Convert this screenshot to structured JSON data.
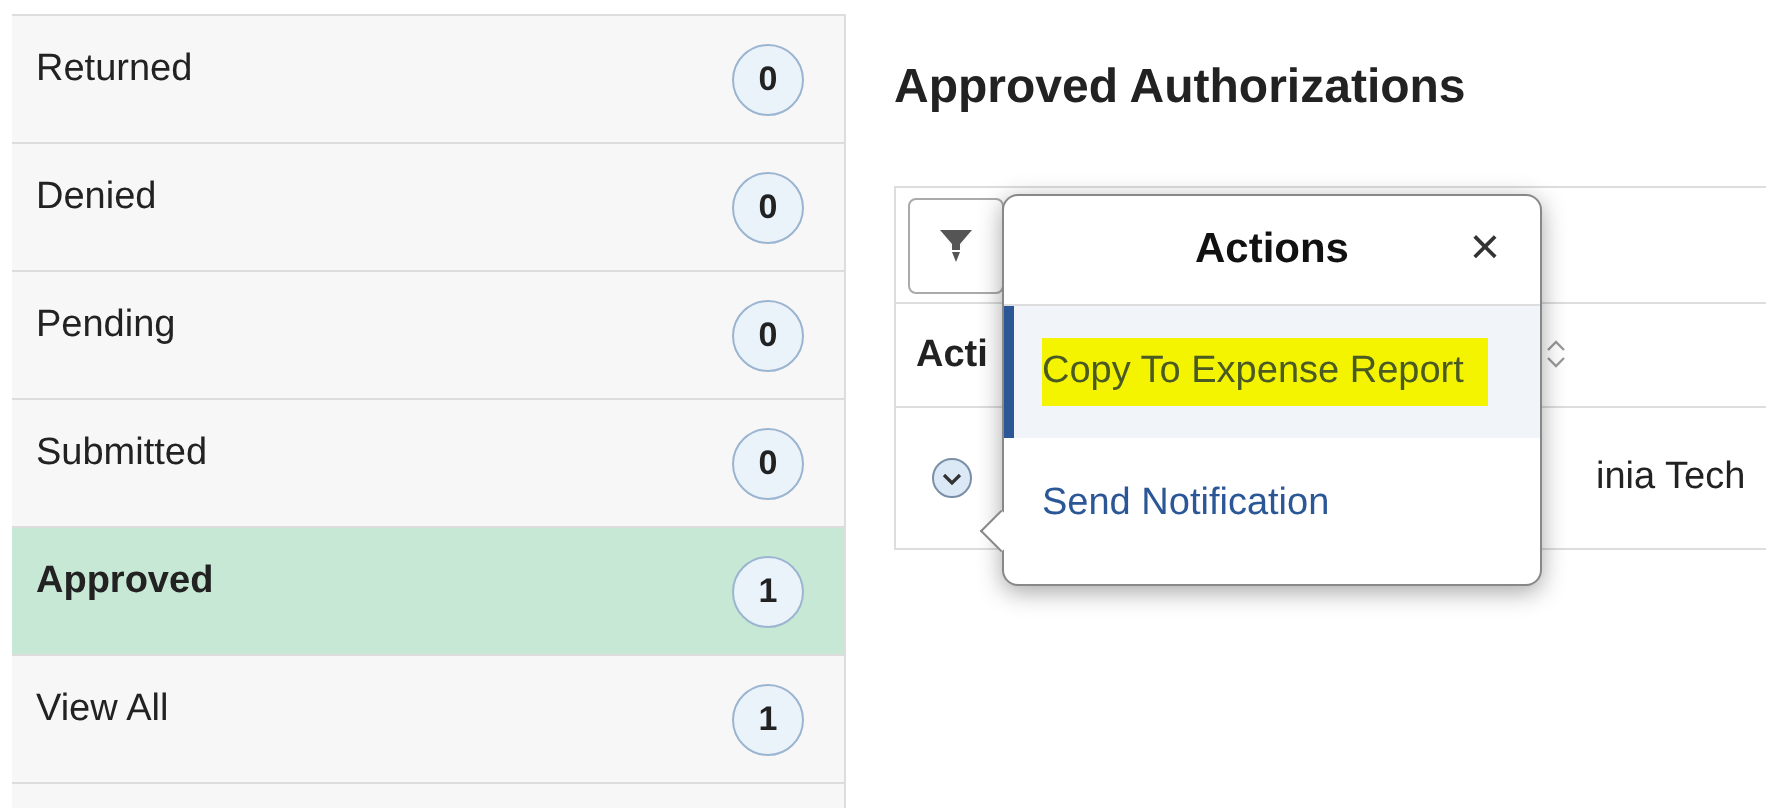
{
  "sidebar": {
    "items": [
      {
        "label": "Returned",
        "count": "0",
        "selected": false
      },
      {
        "label": "Denied",
        "count": "0",
        "selected": false
      },
      {
        "label": "Pending",
        "count": "0",
        "selected": false
      },
      {
        "label": "Submitted",
        "count": "0",
        "selected": false
      },
      {
        "label": "Approved",
        "count": "1",
        "selected": true
      },
      {
        "label": "View All",
        "count": "1",
        "selected": false
      }
    ]
  },
  "main": {
    "title": "Approved Authorizations",
    "table": {
      "header": "Acti",
      "row_cell": "inia Tech"
    }
  },
  "popup": {
    "title": "Actions",
    "close": "×",
    "items": [
      {
        "label": "Copy To Expense Report",
        "selected": true,
        "marked": true
      },
      {
        "label": "Send Notification",
        "selected": false,
        "marked": false
      }
    ]
  }
}
